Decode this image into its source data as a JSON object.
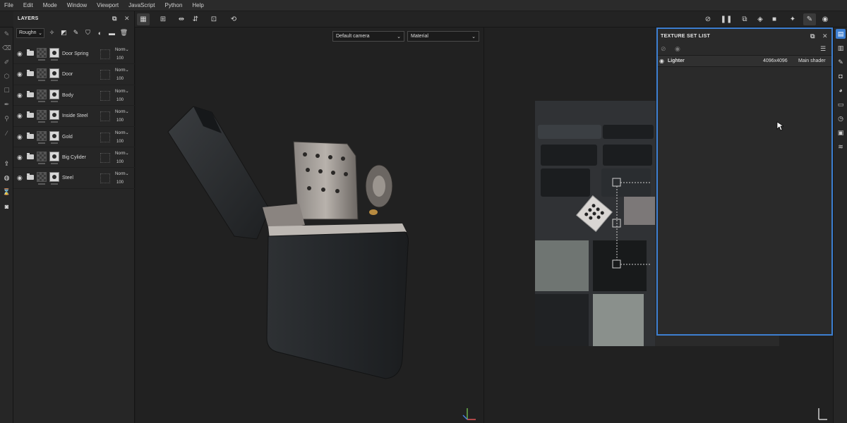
{
  "menu": [
    "File",
    "Edit",
    "Mode",
    "Window",
    "Viewport",
    "JavaScript",
    "Python",
    "Help"
  ],
  "layers_panel": {
    "title": "LAYERS",
    "channel": "Roughn",
    "layers": [
      {
        "name": "Door Spring",
        "blend": "Norm",
        "opacity": "100"
      },
      {
        "name": "Door",
        "blend": "Norm",
        "opacity": "100"
      },
      {
        "name": "Body",
        "blend": "Norm",
        "opacity": "100"
      },
      {
        "name": "Inside Steel",
        "blend": "Norm",
        "opacity": "100"
      },
      {
        "name": "Gold",
        "blend": "Norm",
        "opacity": "100"
      },
      {
        "name": "Big Cylider",
        "blend": "Norm",
        "opacity": "100"
      },
      {
        "name": "Steel",
        "blend": "Norm",
        "opacity": "100"
      }
    ]
  },
  "viewport": {
    "camera": "Default camera",
    "mode": "Material"
  },
  "texture_set_list": {
    "title": "TEXTURE SET LIST",
    "item": {
      "name": "Lighter",
      "resolution": "4096x4096",
      "shader": "Main shader"
    }
  },
  "colors": {
    "accent": "#3d7fd1",
    "panel": "#262626",
    "viewport": "#212121"
  }
}
